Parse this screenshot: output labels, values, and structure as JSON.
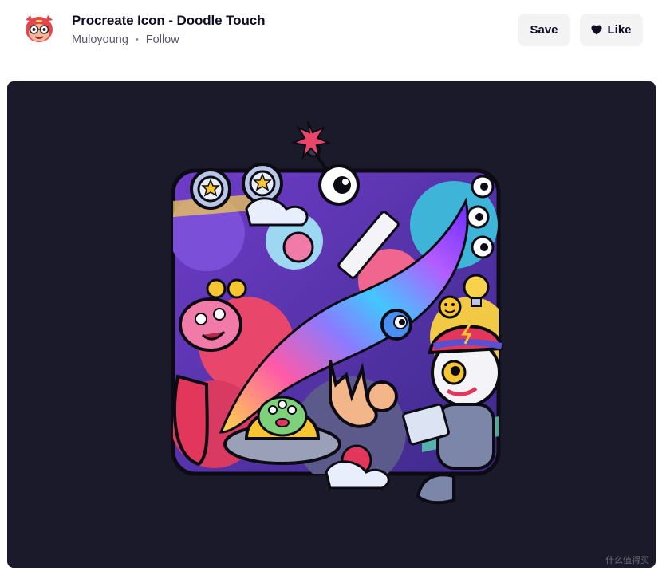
{
  "header": {
    "title": "Procreate Icon - Doodle Touch",
    "author": "Muloyoung",
    "separator": "•",
    "follow_label": "Follow",
    "save_label": "Save",
    "like_label": "Like"
  },
  "shot": {
    "background_color": "#1b1a2a",
    "watermark": "什么值得买"
  },
  "icons": {
    "avatar": "avatar-icon",
    "like": "heart-icon"
  },
  "colors": {
    "button_bg": "#f3f3f4",
    "title": "#0d0c22",
    "meta": "#5a5a6e"
  }
}
